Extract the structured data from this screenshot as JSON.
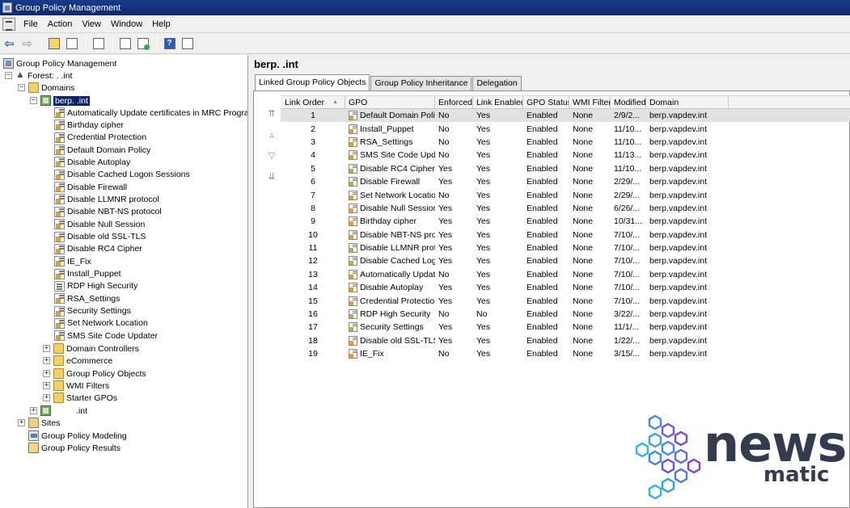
{
  "window": {
    "title": "Group Policy Management"
  },
  "menu": [
    "File",
    "Action",
    "View",
    "Window",
    "Help"
  ],
  "tree": {
    "root": "Group Policy Management",
    "forest": "Forest: .      .int",
    "domains": "Domains",
    "selected_domain": "berp.         .int",
    "gpo_links": [
      "Automatically Update certificates in MRC Program",
      "Birthday cipher",
      "Credential Protection",
      "Default Domain Policy",
      "Disable Autoplay",
      "Disable Cached Logon Sessions",
      "Disable Firewall",
      "Disable LLMNR protocol",
      "Disable NBT-NS protocol",
      "Disable Null Session",
      "Disable old SSL-TLS",
      "Disable RC4 Cipher",
      "IE_Fix",
      "Install_Puppet",
      "RDP High Security",
      "RSA_Settings",
      "Security Settings",
      "Set Network Location",
      "SMS Site Code Updater"
    ],
    "containers": [
      "Domain Controllers",
      "eCommerce",
      "Group Policy Objects",
      "WMI Filters",
      "Starter GPOs"
    ],
    "other_domain": ".int",
    "sites": "Sites",
    "modeling": "Group Policy Modeling",
    "results": "Group Policy Results"
  },
  "right": {
    "title": "berp.         .int",
    "tabs": [
      "Linked Group Policy Objects",
      "Group Policy Inheritance",
      "Delegation"
    ],
    "columns": [
      "Link Order",
      "GPO",
      "Enforced",
      "Link Enabled",
      "GPO Status",
      "WMI Filter",
      "Modified",
      "Domain"
    ],
    "rows": [
      {
        "order": "1",
        "gpo": "Default Domain Policy",
        "enforced": "No",
        "link": "Yes",
        "status": "Enabled",
        "wmi": "None",
        "modified": "2/9/2...",
        "domain": "berp.vapdev.int"
      },
      {
        "order": "2",
        "gpo": "Install_Puppet",
        "enforced": "No",
        "link": "Yes",
        "status": "Enabled",
        "wmi": "None",
        "modified": "11/10...",
        "domain": "berp.vapdev.int"
      },
      {
        "order": "3",
        "gpo": "RSA_Settings",
        "enforced": "No",
        "link": "Yes",
        "status": "Enabled",
        "wmi": "None",
        "modified": "11/10...",
        "domain": "berp.vapdev.int"
      },
      {
        "order": "4",
        "gpo": "SMS Site Code Upd...",
        "enforced": "No",
        "link": "Yes",
        "status": "Enabled",
        "wmi": "None",
        "modified": "11/13...",
        "domain": "berp.vapdev.int"
      },
      {
        "order": "5",
        "gpo": "Disable RC4 Cipher",
        "enforced": "Yes",
        "link": "Yes",
        "status": "Enabled",
        "wmi": "None",
        "modified": "11/10...",
        "domain": "berp.vapdev.int"
      },
      {
        "order": "6",
        "gpo": "Disable Firewall",
        "enforced": "Yes",
        "link": "Yes",
        "status": "Enabled",
        "wmi": "None",
        "modified": "2/29/...",
        "domain": "berp.vapdev.int"
      },
      {
        "order": "7",
        "gpo": "Set Network Location",
        "enforced": "No",
        "link": "Yes",
        "status": "Enabled",
        "wmi": "None",
        "modified": "2/29/...",
        "domain": "berp.vapdev.int"
      },
      {
        "order": "8",
        "gpo": "Disable Null Session",
        "enforced": "Yes",
        "link": "Yes",
        "status": "Enabled",
        "wmi": "None",
        "modified": "6/26/...",
        "domain": "berp.vapdev.int"
      },
      {
        "order": "9",
        "gpo": "Birthday cipher",
        "enforced": "Yes",
        "link": "Yes",
        "status": "Enabled",
        "wmi": "None",
        "modified": "10/31...",
        "domain": "berp.vapdev.int"
      },
      {
        "order": "10",
        "gpo": "Disable NBT-NS pro...",
        "enforced": "Yes",
        "link": "Yes",
        "status": "Enabled",
        "wmi": "None",
        "modified": "7/10/...",
        "domain": "berp.vapdev.int"
      },
      {
        "order": "11",
        "gpo": "Disable LLMNR prot...",
        "enforced": "Yes",
        "link": "Yes",
        "status": "Enabled",
        "wmi": "None",
        "modified": "7/10/...",
        "domain": "berp.vapdev.int"
      },
      {
        "order": "12",
        "gpo": "Disable Cached Log...",
        "enforced": "Yes",
        "link": "Yes",
        "status": "Enabled",
        "wmi": "None",
        "modified": "7/10/...",
        "domain": "berp.vapdev.int"
      },
      {
        "order": "13",
        "gpo": "Automatically Updat...",
        "enforced": "No",
        "link": "Yes",
        "status": "Enabled",
        "wmi": "None",
        "modified": "7/10/...",
        "domain": "berp.vapdev.int"
      },
      {
        "order": "14",
        "gpo": "Disable Autoplay",
        "enforced": "Yes",
        "link": "Yes",
        "status": "Enabled",
        "wmi": "None",
        "modified": "7/10/...",
        "domain": "berp.vapdev.int"
      },
      {
        "order": "15",
        "gpo": "Credential Protection",
        "enforced": "Yes",
        "link": "Yes",
        "status": "Enabled",
        "wmi": "None",
        "modified": "7/10/...",
        "domain": "berp.vapdev.int"
      },
      {
        "order": "16",
        "gpo": "RDP High Security",
        "enforced": "No",
        "link": "No",
        "status": "Enabled",
        "wmi": "None",
        "modified": "3/22/...",
        "domain": "berp.vapdev.int"
      },
      {
        "order": "17",
        "gpo": "Security Settings",
        "enforced": "Yes",
        "link": "Yes",
        "status": "Enabled",
        "wmi": "None",
        "modified": "11/1/...",
        "domain": "berp.vapdev.int"
      },
      {
        "order": "18",
        "gpo": "Disable old SSL-TLS",
        "enforced": "Yes",
        "link": "Yes",
        "status": "Enabled",
        "wmi": "None",
        "modified": "1/22/...",
        "domain": "berp.vapdev.int"
      },
      {
        "order": "19",
        "gpo": "IE_Fix",
        "enforced": "No",
        "link": "Yes",
        "status": "Enabled",
        "wmi": "None",
        "modified": "3/15/...",
        "domain": "berp.vapdev.int"
      }
    ]
  },
  "watermark": {
    "main": "news",
    "sub": "matic"
  },
  "colors": {
    "title_bar": "#0b2a6f",
    "selection": "#0a246a",
    "watermark_blue": "#2f6fe0",
    "watermark_text": "#333b4f"
  }
}
